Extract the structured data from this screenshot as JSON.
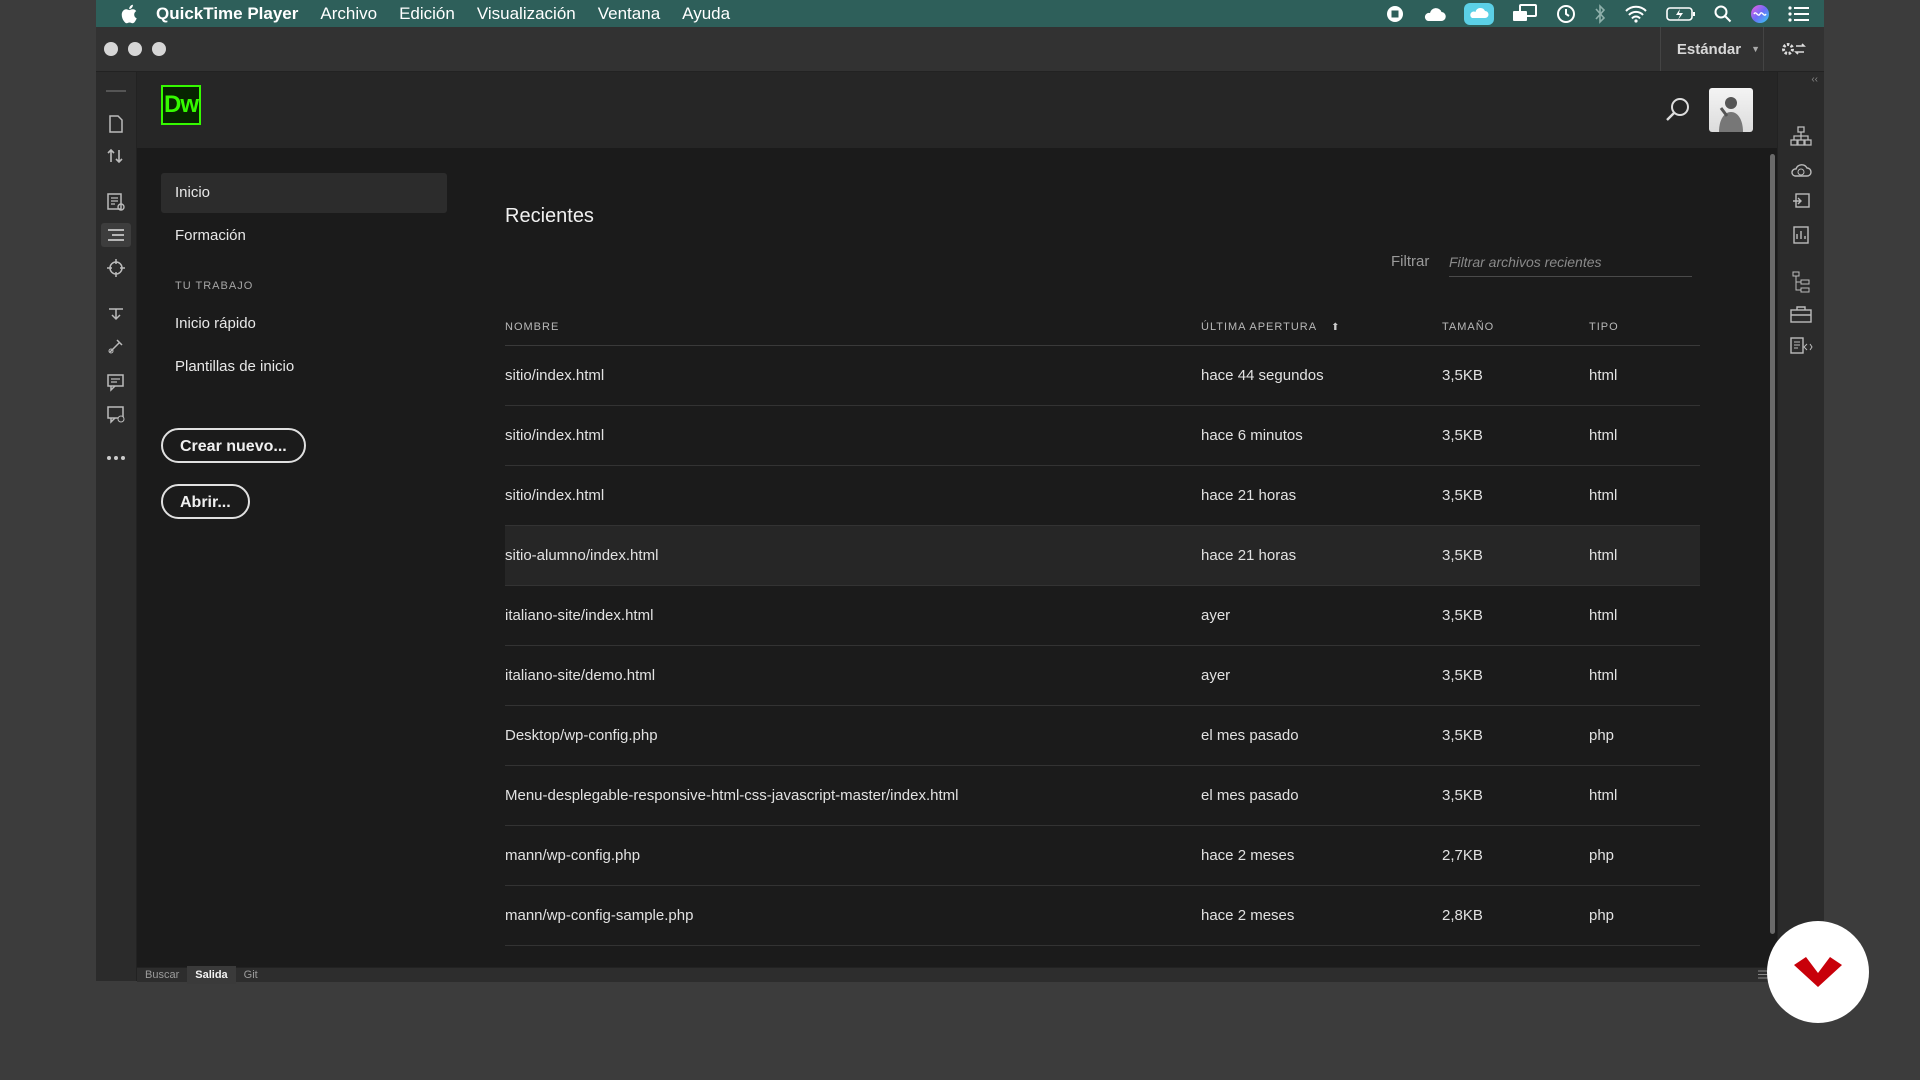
{
  "menubar": {
    "app_name": "QuickTime Player",
    "items": [
      "Archivo",
      "Edición",
      "Visualización",
      "Ventana",
      "Ayuda"
    ],
    "status_icons": [
      "stop-recording-icon",
      "creative-cloud-icon",
      "cloud-sync-icon",
      "screen-mirror-icon",
      "time-machine-icon",
      "bluetooth-icon",
      "wifi-icon",
      "battery-icon",
      "spotlight-icon",
      "siri-icon",
      "control-center-icon"
    ]
  },
  "window": {
    "workspace": "Estándar"
  },
  "app": {
    "logo": "Dw"
  },
  "nav": {
    "items": [
      "Inicio",
      "Formación"
    ],
    "section_title": "TU TRABAJO",
    "work_items": [
      "Inicio rápido",
      "Plantillas de inicio"
    ],
    "create_button": "Crear nuevo...",
    "open_button": "Abrir..."
  },
  "recent": {
    "title": "Recientes",
    "filter_label": "Filtrar",
    "filter_placeholder": "Filtrar archivos recientes",
    "columns": [
      "NOMBRE",
      "ÚLTIMA APERTURA",
      "TAMAÑO",
      "TIPO"
    ],
    "rows": [
      {
        "name": "sitio/index.html",
        "opened": "hace 44 segundos",
        "size": "3,5KB",
        "type": "html"
      },
      {
        "name": "sitio/index.html",
        "opened": "hace 6 minutos",
        "size": "3,5KB",
        "type": "html"
      },
      {
        "name": "sitio/index.html",
        "opened": "hace 21 horas",
        "size": "3,5KB",
        "type": "html"
      },
      {
        "name": "sitio-alumno/index.html",
        "opened": "hace 21 horas",
        "size": "3,5KB",
        "type": "html"
      },
      {
        "name": "italiano-site/index.html",
        "opened": "ayer",
        "size": "3,5KB",
        "type": "html"
      },
      {
        "name": "italiano-site/demo.html",
        "opened": "ayer",
        "size": "3,5KB",
        "type": "html"
      },
      {
        "name": "Desktop/wp-config.php",
        "opened": "el mes pasado",
        "size": "3,5KB",
        "type": "php"
      },
      {
        "name": "Menu-desplegable-responsive-html-css-javascript-master/index.html",
        "opened": "el mes pasado",
        "size": "3,5KB",
        "type": "html"
      },
      {
        "name": "mann/wp-config.php",
        "opened": "hace 2 meses",
        "size": "2,7KB",
        "type": "php"
      },
      {
        "name": "mann/wp-config-sample.php",
        "opened": "hace 2 meses",
        "size": "2,8KB",
        "type": "php"
      }
    ]
  },
  "bottom_tabs": [
    "Buscar",
    "Salida",
    "Git"
  ],
  "colors": {
    "menubar": "#2e5f5a",
    "dw_green": "#35fa00",
    "badge_red": "#c8000a"
  }
}
